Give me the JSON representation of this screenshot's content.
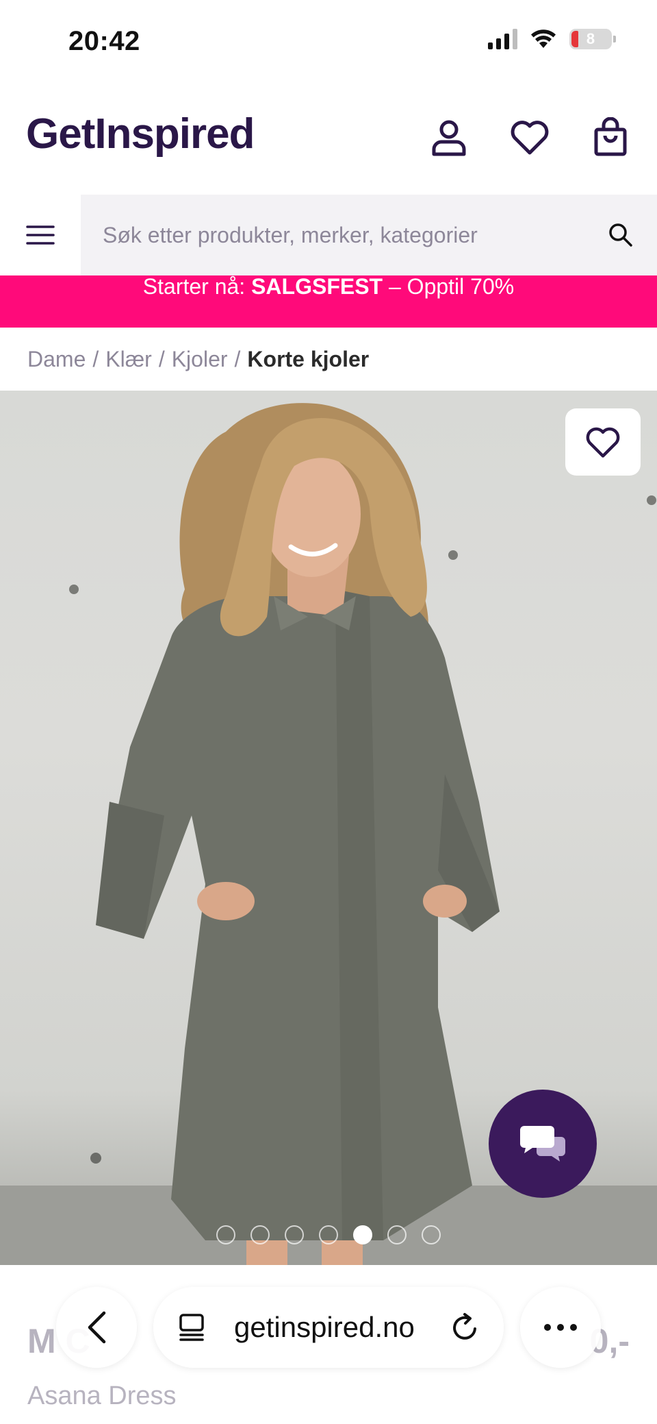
{
  "status_bar": {
    "time": "20:42",
    "battery": "8"
  },
  "header": {
    "logo": "GetInspired",
    "icons": [
      "account-icon",
      "heart-icon",
      "shopping-bag-icon"
    ]
  },
  "search": {
    "placeholder": "Søk etter produkter, merker, kategorier"
  },
  "promo": {
    "prefix": "Starter nå: ",
    "highlight": "SALGSFEST",
    "suffix": " – Opptil 70%"
  },
  "breadcrumb": {
    "items": [
      "Dame",
      "Klær",
      "Kjoler"
    ],
    "current": "Korte kjoler",
    "separator": "/"
  },
  "gallery": {
    "slides": 7,
    "active_slide": 5
  },
  "product": {
    "brand": "M  C",
    "price": "0,-",
    "name": "Asana Dress"
  },
  "browser": {
    "url": "getinspired.no"
  },
  "colors": {
    "brand": "#2a1748",
    "promo": "#ff0a7a",
    "chat": "#3b1a5c"
  }
}
